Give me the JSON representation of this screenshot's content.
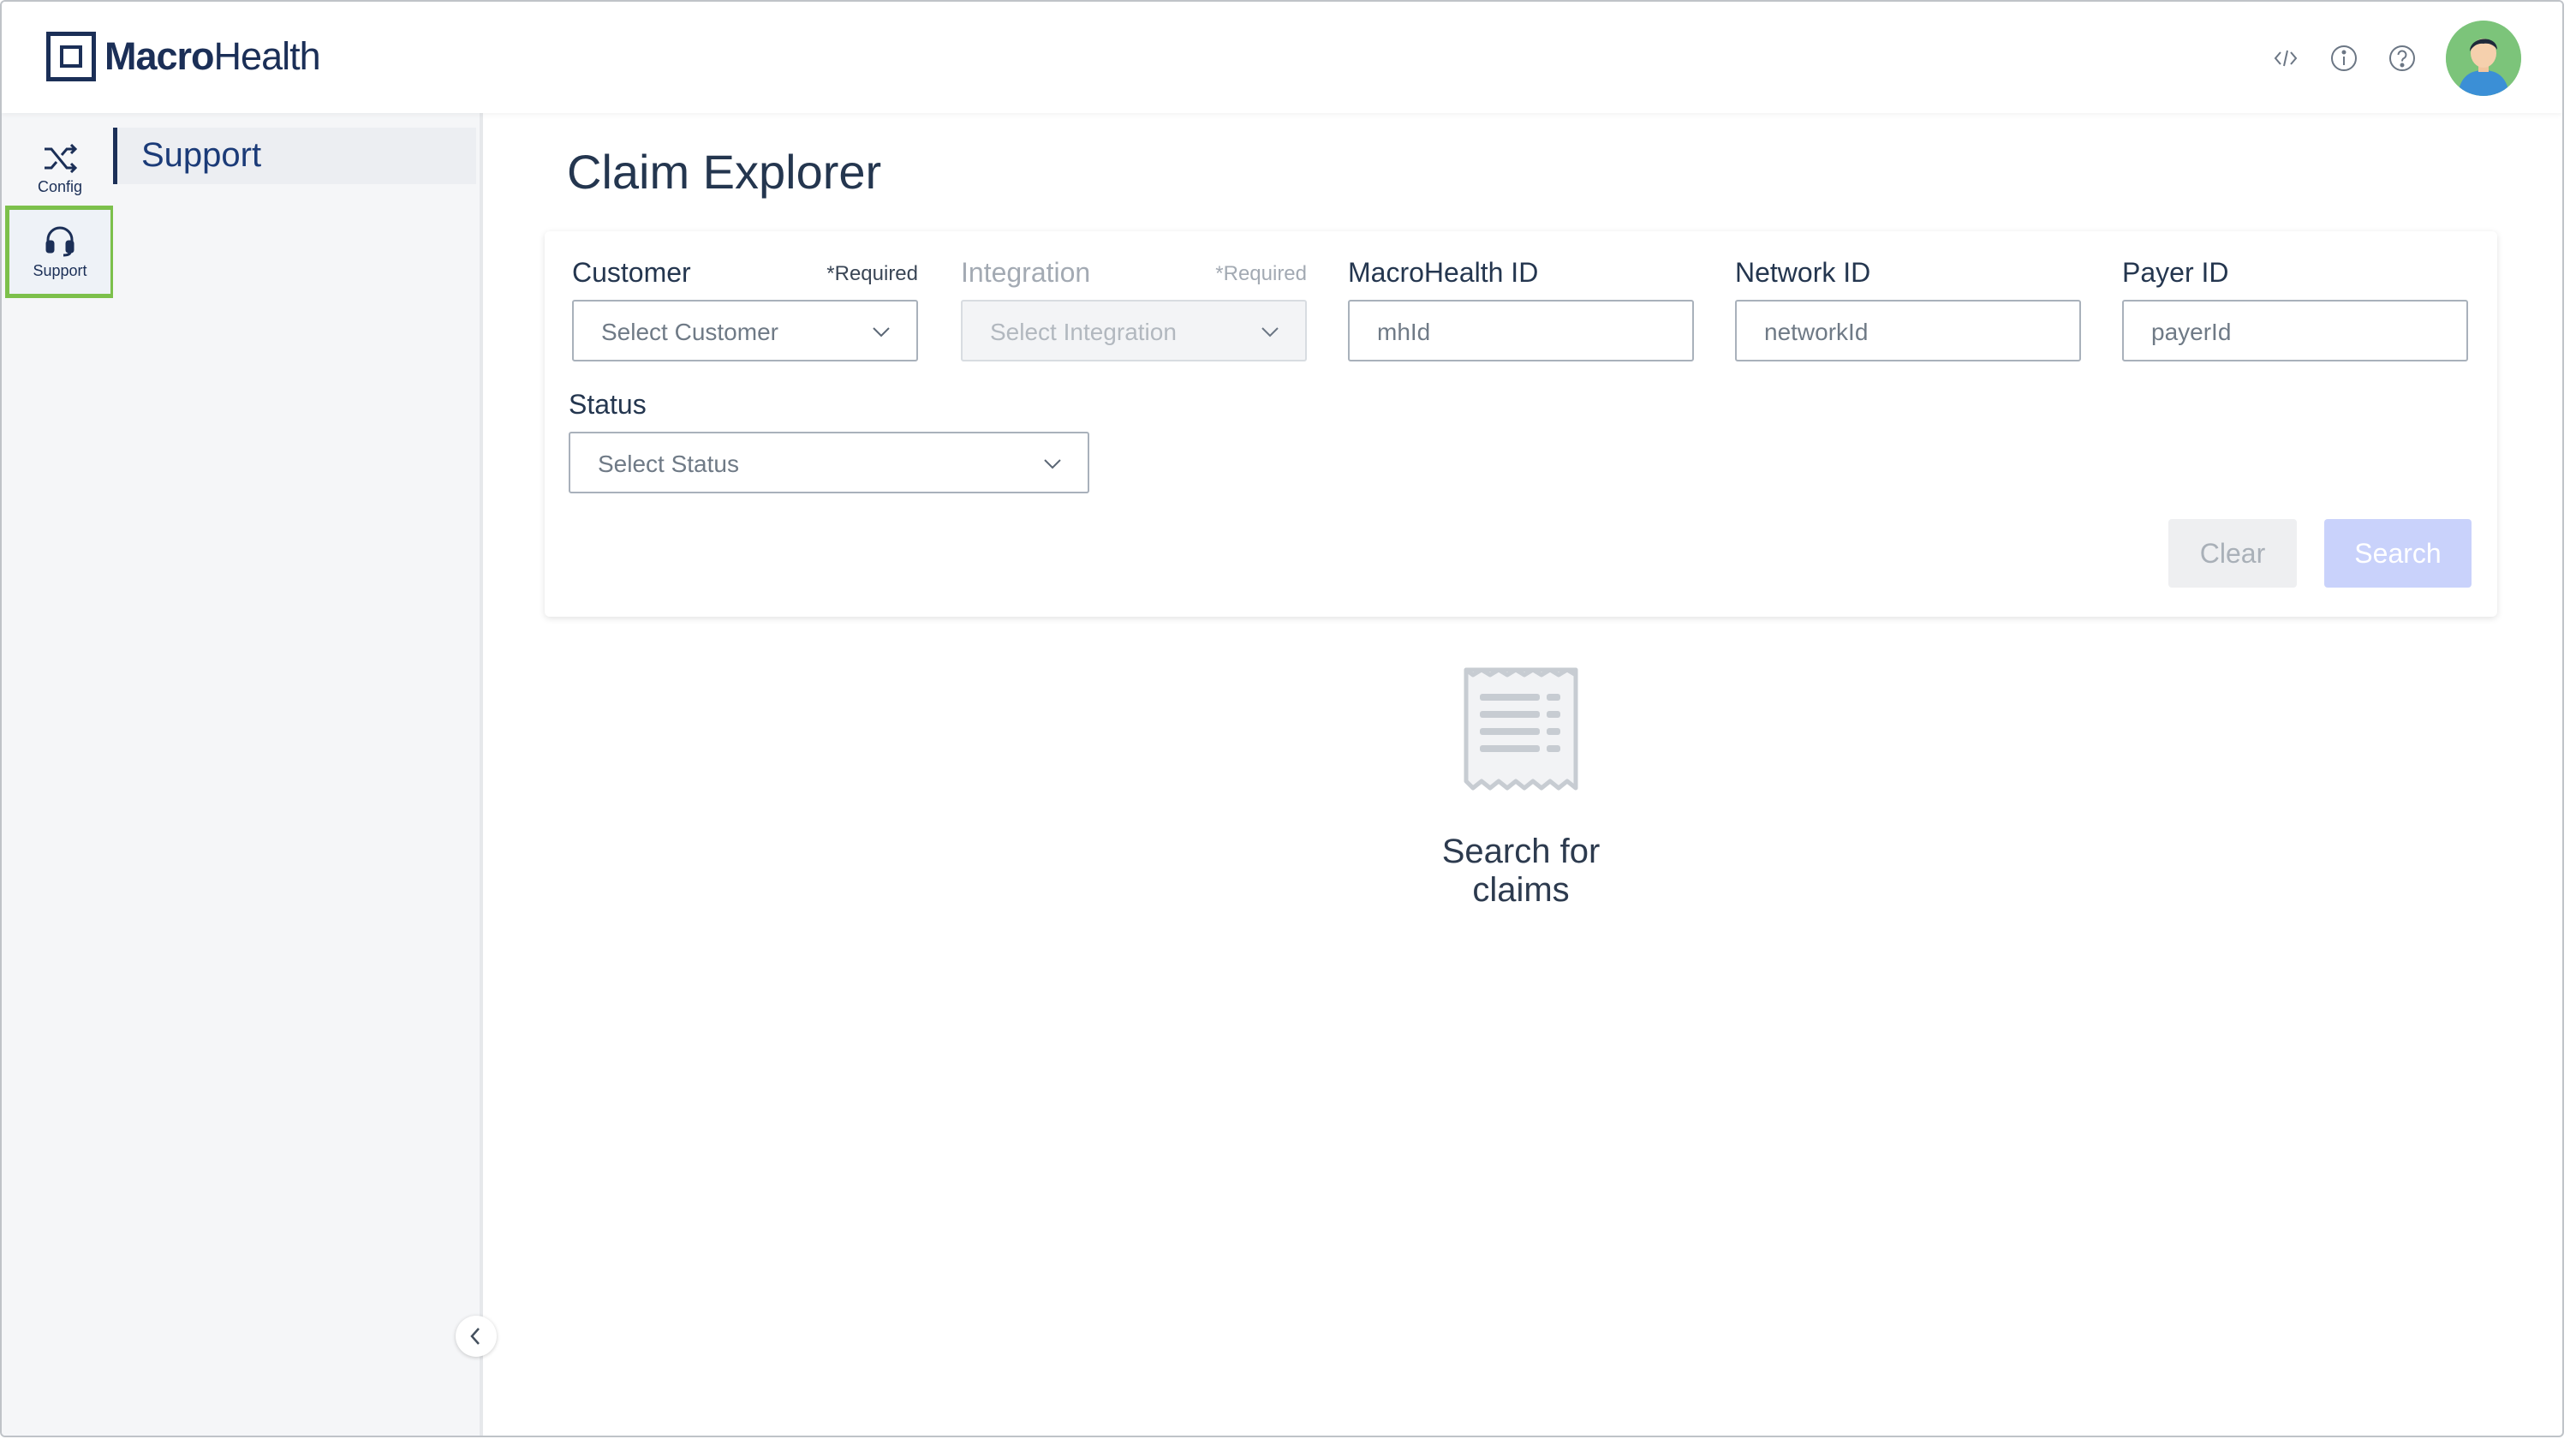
{
  "header": {
    "logo_bold": "Macro",
    "logo_light": "Health",
    "icons": [
      "code-icon",
      "info-icon",
      "help-icon",
      "avatar"
    ]
  },
  "rail": {
    "items": [
      {
        "label": "Config",
        "icon": "shuffle-icon",
        "active": false
      },
      {
        "label": "Support",
        "icon": "headset-icon",
        "active": true
      }
    ]
  },
  "sidebar": {
    "items": [
      {
        "label": "Support",
        "active": true
      }
    ]
  },
  "main": {
    "title": "Claim Explorer",
    "filters": {
      "customer": {
        "label": "Customer",
        "required": "*Required",
        "placeholder": "Select Customer"
      },
      "integration": {
        "label": "Integration",
        "required": "*Required",
        "placeholder": "Select Integration",
        "disabled": true
      },
      "macrohealth_id": {
        "label": "MacroHealth ID",
        "placeholder": "mhId"
      },
      "network_id": {
        "label": "Network ID",
        "placeholder": "networkId"
      },
      "payer_id": {
        "label": "Payer ID",
        "placeholder": "payerId"
      },
      "status": {
        "label": "Status",
        "placeholder": "Select Status"
      }
    },
    "buttons": {
      "clear": "Clear",
      "search": "Search"
    },
    "empty_state": {
      "icon": "receipt-icon",
      "message": "Search for claims"
    }
  },
  "colors": {
    "brand_navy": "#1b2f57",
    "active_highlight": "#7cc04b",
    "search_button_disabled": "#c9d2fb"
  }
}
